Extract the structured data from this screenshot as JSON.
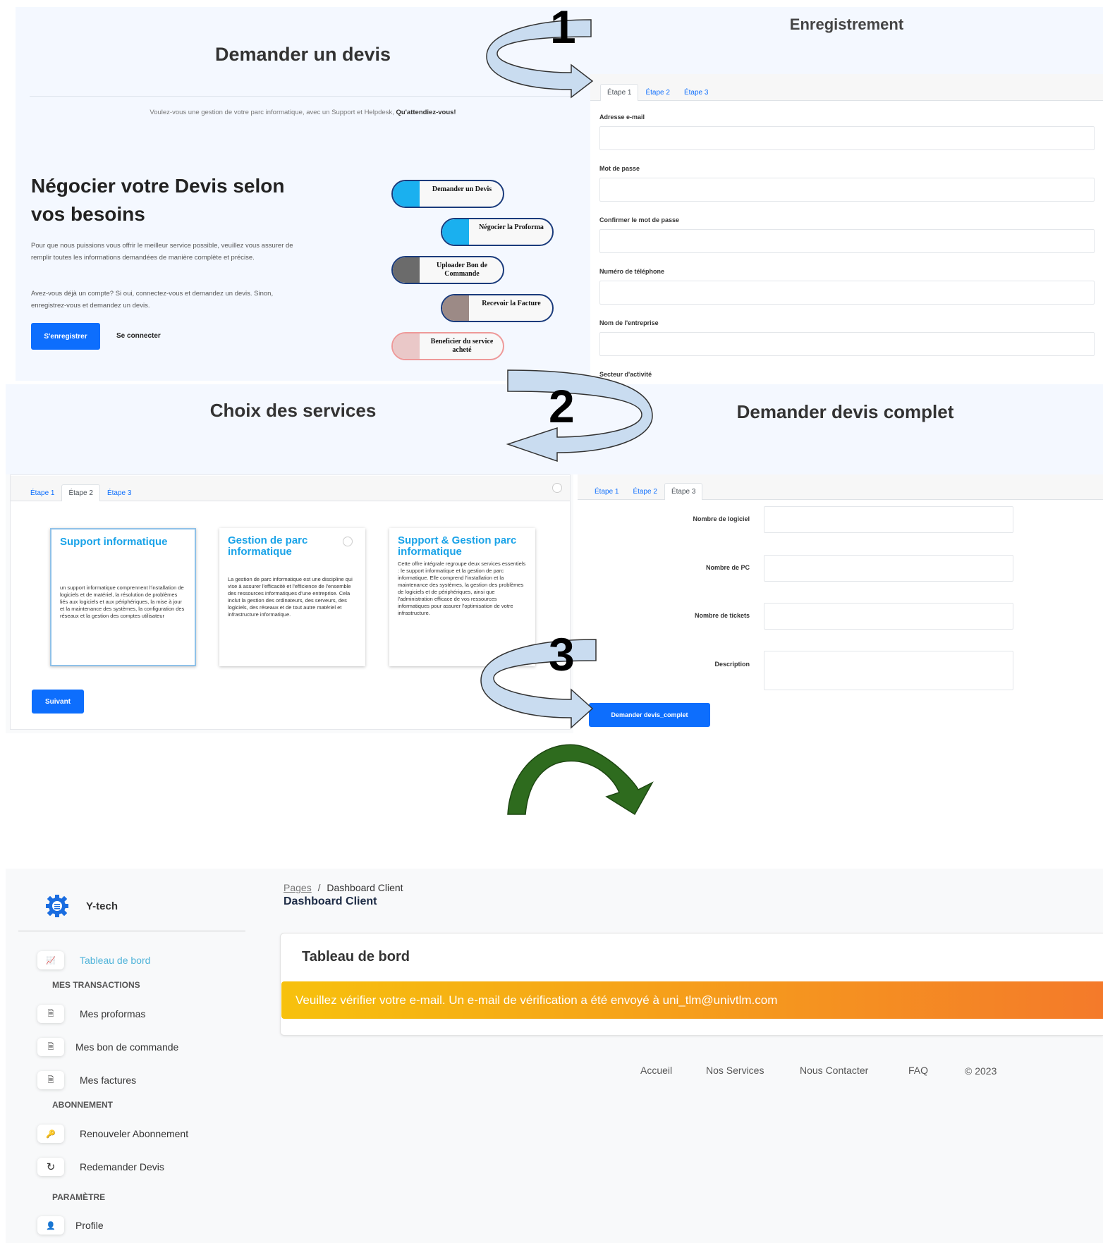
{
  "panel1": {
    "title": "Demander un devis",
    "subtitle_plain": "Voulez-vous une gestion de votre parc informatique, avec un Support et Helpdesk, ",
    "subtitle_bold": "Qu'attendiez-vous!",
    "heading": "Négocier votre Devis selon vos besoins",
    "para1": "Pour que nous puissions vous offrir le meilleur service possible, veuillez vous assurer de remplir toutes les informations demandées de manière complète et précise.",
    "para2": "Avez-vous déjà un compte? Si oui, connectez-vous et demandez un devis. Sinon, enregistrez-vous et demandez un devis.",
    "register_label": "S'enregistrer",
    "login_label": "Se connecter",
    "steps": [
      {
        "label": "Demander un Devis",
        "color": "#1ab0ef"
      },
      {
        "label": "Négocier la Proforma",
        "color": "#1ab0ef"
      },
      {
        "label": "Uploader Bon de Commande",
        "color": "#6b6b6b"
      },
      {
        "label": "Recevoir la Facture",
        "color": "#9c8a86"
      },
      {
        "label": "Beneficier du service acheté",
        "color": "#eac8c8"
      }
    ]
  },
  "panel2": {
    "title": "Enregistrement",
    "tabs": [
      "Étape 1",
      "Étape 2",
      "Étape 3"
    ],
    "fields": [
      "Adresse e-mail",
      "Mot de passe",
      "Confirmer le mot de passe",
      "Numéro de téléphone",
      "Nom de l'entreprise",
      "Secteur d'activité"
    ]
  },
  "panel3": {
    "title": "Choix des services",
    "tabs": [
      "Étape 1",
      "Étape 2",
      "Étape 3"
    ],
    "cards": [
      {
        "title": "Support informatique",
        "text": "un support informatique comprennent l'installation de logiciels et de matériel, la résolution de problèmes liés aux logiciels et aux périphériques, la mise à jour et la maintenance des systèmes, la configuration des réseaux et la gestion des comptes utilisateur"
      },
      {
        "title": "Gestion de parc informatique",
        "text": "La gestion de parc informatique est une discipline qui vise à assurer l'efficacité et l'efficience de l'ensemble des ressources informatiques d'une entreprise. Cela inclut la gestion des ordinateurs, des serveurs, des logiciels, des réseaux et de tout autre matériel et infrastructure informatique."
      },
      {
        "title": "Support & Gestion parc informatique",
        "text": "Cette offre intégrale regroupe deux services essentiels : le support informatique et la gestion de parc informatique. Elle comprend l'installation et la maintenance des systèmes, la gestion des problèmes de logiciels et de périphériques, ainsi que l'administration efficace de vos ressources informatiques pour assurer l'optimisation de votre infrastructure."
      }
    ],
    "next_label": "Suivant"
  },
  "panel4": {
    "title": "Demander devis complet",
    "tabs": [
      "Étape 1",
      "Étape 2",
      "Étape 3"
    ],
    "fields": [
      "Nombre de logiciel",
      "Nombre de PC",
      "Nombre de tickets",
      "Description"
    ],
    "submit_label": "Demander devis_complet"
  },
  "step_numbers": [
    "1",
    "2",
    "3"
  ],
  "dashboard": {
    "brand": "Y-tech",
    "breadcrumb_link": "Pages",
    "breadcrumb_sep": "/",
    "breadcrumb_current": "Dashboard Client",
    "page_title": "Dashboard Client",
    "card_title": "Tableau de bord",
    "alert": "Veuillez vérifier votre e-mail. Un e-mail de vérification a été envoyé à uni_tlm@univtlm.com",
    "sidebar": {
      "dashboard": "Tableau de bord",
      "section_transactions": "MES TRANSACTIONS",
      "proformas": "Mes proformas",
      "bons": "Mes bon de commande",
      "factures": "Mes factures",
      "section_abonnement": "ABONNEMENT",
      "renouveler": "Renouveler Abonnement",
      "redemander": "Redemander Devis",
      "section_parametre": "PARAMÈTRE",
      "profile": "Profile"
    },
    "footer": [
      "Accueil",
      "Nos Services",
      "Nous Contacter",
      "FAQ",
      "© 2023"
    ]
  },
  "colors": {
    "accent": "#0d6efd",
    "light_bg": "#f4f8ff",
    "card_title": "#1aa3e8",
    "sidebar_active": "#4fb3d9",
    "alert_start": "#f7c10d",
    "alert_end": "#f47a2a",
    "arrow_fill": "#c9dcf0",
    "green_arrow": "#2e6b1e"
  }
}
